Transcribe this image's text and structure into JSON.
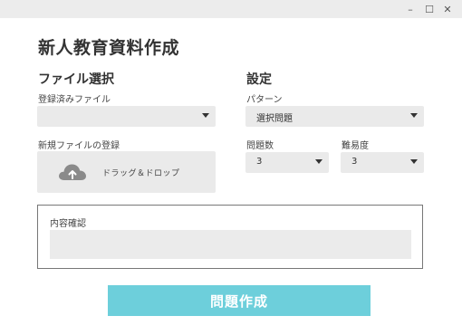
{
  "window": {
    "minimize_icon": "–",
    "maximize_icon": "☐",
    "close_icon": "✕"
  },
  "app": {
    "title": "新人教育資料作成"
  },
  "file_section": {
    "title": "ファイル選択",
    "registered_label": "登録済みファイル",
    "registered_value": "",
    "new_file_label": "新規ファイルの登録",
    "dropzone_text": "ドラッグ＆ドロップ"
  },
  "settings": {
    "title": "設定",
    "pattern_label": "パターン",
    "pattern_value": "選択問題",
    "count_label": "問題数",
    "count_value": "3",
    "difficulty_label": "難易度",
    "difficulty_value": "3"
  },
  "confirm": {
    "title": "内容確認",
    "content": ""
  },
  "actions": {
    "create_label": "問題作成"
  },
  "colors": {
    "accent": "#6dcfdb",
    "field_bg": "#eaeaea",
    "titlebar_bg": "#ececec"
  }
}
